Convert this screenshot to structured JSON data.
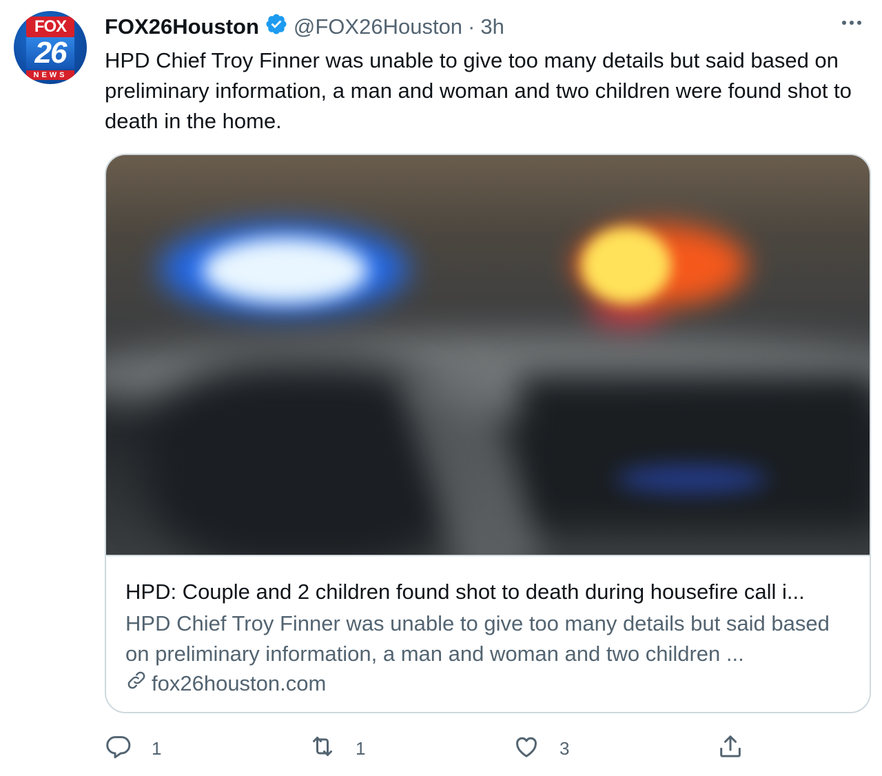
{
  "avatar": {
    "brand": "FOX",
    "number": "26",
    "subtitle": "NEWS"
  },
  "author": {
    "display_name": "FOX26Houston",
    "handle": "@FOX26Houston",
    "separator": "·",
    "time": "3h"
  },
  "tweet_text": "HPD Chief Troy Finner was unable to give too many details but said based on preliminary information, a man and woman and two children were found shot to death in the home.",
  "card": {
    "title": "HPD: Couple and 2 children found shot to death during housefire call i...",
    "description": "HPD Chief Troy Finner was unable to give too many details but said based on preliminary information, a man and woman and two children ...",
    "domain": "fox26houston.com"
  },
  "actions": {
    "reply_count": "1",
    "retweet_count": "1",
    "like_count": "3"
  },
  "icons": {
    "verified": "verified-badge-icon",
    "more": "more-options-icon",
    "link": "link-icon",
    "reply": "reply-icon",
    "retweet": "retweet-icon",
    "like": "heart-icon",
    "share": "share-icon"
  },
  "colors": {
    "text_primary": "#0f1419",
    "text_secondary": "#536471",
    "verified_blue": "#1d9bf0",
    "border": "#cfd9de",
    "fox_red": "#d6202a",
    "fox_blue": "#1456b5"
  }
}
